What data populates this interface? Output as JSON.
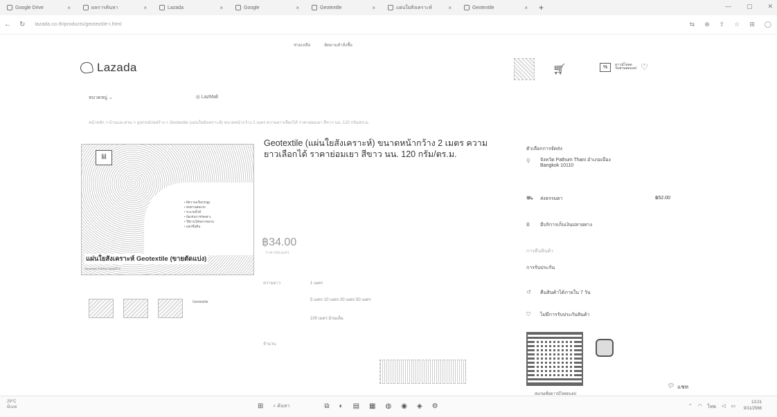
{
  "browser": {
    "tabs": [
      {
        "label": "Google Drive"
      },
      {
        "label": "ผลการค้นหา"
      },
      {
        "label": "Lazada"
      },
      {
        "label": "Google"
      },
      {
        "label": "Geotextile"
      },
      {
        "label": "แผ่นใยสังเคราะห์"
      },
      {
        "label": "Geotextile"
      }
    ],
    "new_tab": "+",
    "url": "lazada.co.th/products/geotextile-i.html"
  },
  "site": {
    "top_links": [
      "ช่วยเหลือ",
      "ติดตามคำสั่งซื้อ"
    ],
    "logo_text": "Lazada",
    "promo_badge": "%",
    "promo_text": [
      "ดาวน์โหลด",
      "รับส่วนลดแอป"
    ],
    "subnav": [
      "หมวดหมู่",
      "LazMall"
    ],
    "breadcrumb": "หน้าหลัก > บ้านและสวน > อุปกรณ์ก่อสร้าง > Geotextile (แผ่นใยสังเคราะห์) ขนาดหน้ากว้าง 2 เมตร ความยาวเลือกได้ ราคาย่อมเยา สีขาว นน. 120 กรัม/ตร.ม."
  },
  "gallery": {
    "logo_mark": "lil",
    "spec_lines": [
      "• มีความแข็งแรงสูง",
      "• ทนทานต่อแรง",
      "• ระบายน้ำดี",
      "• ป้องกันการกัดเซาะ",
      "• ใช้งานได้หลากหลาย",
      "• แยกชั้นดิน"
    ],
    "caption": "แผ่นใยสังเคราะห์ Geotextile (ขายตัดแบ่ง)",
    "sub_caption": "Geotextile สำหรับงานก่อสร้าง",
    "thumb_label": "Geotextile"
  },
  "product": {
    "title": "Geotextile (แผ่นใยสังเคราะห์) ขนาดหน้ากว้าง 2 เมตร ความยาวเลือกได้ ราคาย่อมเยา สีขาว นน. 120 กรัม/ตร.ม.",
    "price": "฿34.00",
    "price_sub": "ราคาต่อเมตร",
    "options": [
      {
        "label": "ความยาว",
        "value": "1 เมตร"
      },
      {
        "label": "",
        "value": "5 เมตร   10 เมตร   20 เมตร   50 เมตร"
      },
      {
        "label": "",
        "value": "100 เมตร   ม้วนเต็ม"
      }
    ],
    "qty_label": "จำนวน"
  },
  "delivery": {
    "header": "ตัวเลือกการจัดส่ง",
    "address": "จังหวัด Pathum Thani อำเภอเมือง Bangkok 10110",
    "shipping_label": "ส่งธรรมดา",
    "shipping_price": "฿52.00",
    "cod": "มีบริการเก็บเงินปลายทาง",
    "return_header": "การคืนสินค้า",
    "return_title": "การรับประกัน",
    "return_policy": "คืนสินค้าได้ภายใน 7 วัน",
    "warranty": "ไม่มีการรับประกันสินค้า",
    "qr_caption": "สแกนเพื่อดาวน์โหลดแอป",
    "chat": "แชท"
  },
  "taskbar": {
    "weather": [
      "29°C",
      "มีเมฆ"
    ],
    "search_placeholder": "ค้นหา",
    "time": "13:21",
    "date": "9/11/2566"
  }
}
